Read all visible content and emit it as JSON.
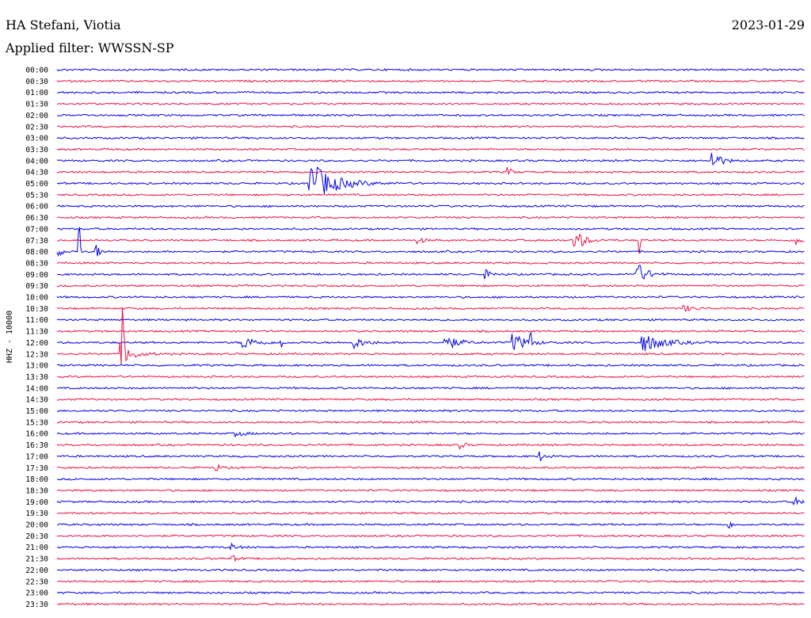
{
  "header": {
    "station": "HA Stefani, Viotia",
    "date": "2023-01-29",
    "filter": "Applied filter: WWSSN-SP"
  },
  "chart_data": {
    "type": "line",
    "subtype": "helicorder",
    "ylabel": "HHZ - 10000",
    "row_labels": [
      "00:00",
      "00:30",
      "01:00",
      "01:30",
      "02:00",
      "02:30",
      "03:00",
      "03:30",
      "04:00",
      "04:30",
      "05:00",
      "05:30",
      "06:00",
      "06:30",
      "07:00",
      "07:30",
      "08:00",
      "08:30",
      "09:00",
      "09:30",
      "10:00",
      "10:30",
      "11:00",
      "11:30",
      "12:00",
      "12:30",
      "13:00",
      "13:30",
      "14:00",
      "14:30",
      "15:00",
      "15:30",
      "16:00",
      "16:30",
      "17:00",
      "17:30",
      "18:00",
      "18:30",
      "19:00",
      "19:30",
      "20:00",
      "20:30",
      "21:00",
      "21:30",
      "22:00",
      "22:30",
      "23:00",
      "23:30"
    ],
    "x_unit": "minutes into row",
    "xlim": [
      0,
      30
    ],
    "trace_colors": [
      "#0000ee",
      "#ee1144"
    ],
    "events": [
      {
        "row": "05:00",
        "minute": 10.1,
        "amp": 30,
        "dur": 1.8
      },
      {
        "row": "04:00",
        "minute": 26.3,
        "amp": 15,
        "dur": 0.6
      },
      {
        "row": "04:30",
        "minute": 18.1,
        "amp": 6,
        "dur": 0.3
      },
      {
        "row": "08:00",
        "minute": 0.9,
        "amp": 60,
        "dur": 0.05
      },
      {
        "row": "08:00",
        "minute": 0.1,
        "amp": 10,
        "dur": 0.2
      },
      {
        "row": "08:00",
        "minute": 1.6,
        "amp": 8,
        "dur": 0.3
      },
      {
        "row": "07:30",
        "minute": 14.5,
        "amp": 5,
        "dur": 0.4
      },
      {
        "row": "07:30",
        "minute": 20.8,
        "amp": 15,
        "dur": 0.7
      },
      {
        "row": "07:30",
        "minute": 29.7,
        "amp": 8,
        "dur": 0.4
      },
      {
        "row": "07:30",
        "minute": 23.4,
        "amp": 25,
        "dur": 0.05
      },
      {
        "row": "09:00",
        "minute": 17.2,
        "amp": 5,
        "dur": 0.5
      },
      {
        "row": "09:00",
        "minute": 23.2,
        "amp": 18,
        "dur": 0.8
      },
      {
        "row": "10:30",
        "minute": 25.2,
        "amp": 4,
        "dur": 0.6
      },
      {
        "row": "12:00",
        "minute": 7.5,
        "amp": 8,
        "dur": 1.0
      },
      {
        "row": "12:00",
        "minute": 9.0,
        "amp": 20,
        "dur": 0.05
      },
      {
        "row": "12:00",
        "minute": 11.9,
        "amp": 7,
        "dur": 0.9
      },
      {
        "row": "12:00",
        "minute": 15.6,
        "amp": 9,
        "dur": 1.0
      },
      {
        "row": "12:00",
        "minute": 18.3,
        "amp": 12,
        "dur": 1.0
      },
      {
        "row": "12:00",
        "minute": 23.5,
        "amp": 12,
        "dur": 1.6
      },
      {
        "row": "12:00",
        "minute": 19.0,
        "amp": 28,
        "dur": 0.05
      },
      {
        "row": "12:30",
        "minute": 2.6,
        "amp": 14,
        "dur": 0.9
      },
      {
        "row": "12:30",
        "minute": 2.7,
        "amp": 45,
        "dur": 0.05
      },
      {
        "row": "16:00",
        "minute": 7.2,
        "amp": 3,
        "dur": 0.8
      },
      {
        "row": "16:30",
        "minute": 16.2,
        "amp": 5,
        "dur": 0.3
      },
      {
        "row": "17:00",
        "minute": 19.4,
        "amp": 6,
        "dur": 0.4
      },
      {
        "row": "17:30",
        "minute": 6.4,
        "amp": 5,
        "dur": 0.3
      },
      {
        "row": "19:00",
        "minute": 29.6,
        "amp": 5,
        "dur": 0.6
      },
      {
        "row": "20:00",
        "minute": 27.0,
        "amp": 4,
        "dur": 0.3
      },
      {
        "row": "21:00",
        "minute": 7.0,
        "amp": 4,
        "dur": 0.5
      },
      {
        "row": "21:30",
        "minute": 7.0,
        "amp": 4,
        "dur": 0.5
      }
    ]
  }
}
